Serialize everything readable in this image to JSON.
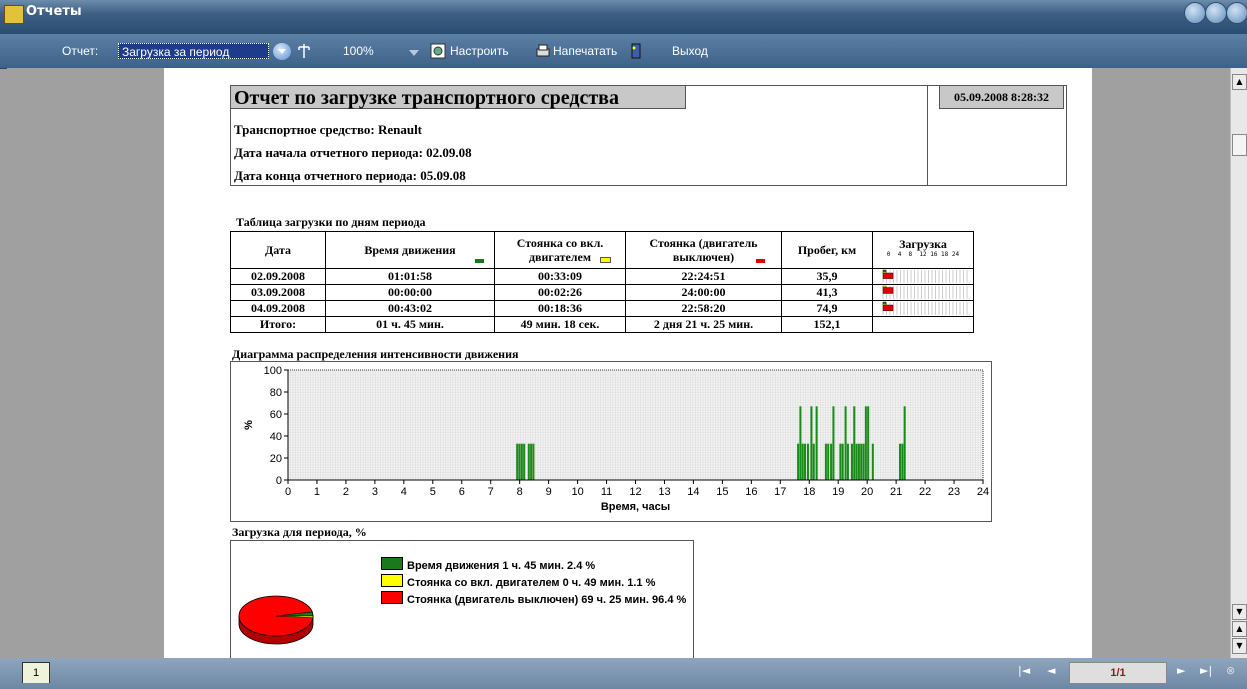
{
  "window": {
    "title": "Отчеты"
  },
  "toolbar": {
    "report_label": "Отчет:",
    "report_value": "Загрузка за период",
    "zoom": "100%",
    "configure_label": "Настроить",
    "print_label": "Напечатать",
    "exit_label": "Выход"
  },
  "report": {
    "title": "Отчет по загрузке транспортного средства",
    "generated": "05.09.2008 8:28:32",
    "vehicle": "Транспортное средство: Renault",
    "period_start": "Дата начала отчетного периода: 02.09.08",
    "period_end": "Дата конца отчетного периода: 05.09.08",
    "table_title": "Таблица загрузки по дням периода",
    "columns": [
      "Дата",
      "Время движения",
      "Стоянка со вкл. двигателем",
      "Стоянка (двигатель выключен)",
      "Пробег, км",
      "Загрузка"
    ],
    "mini_axis": "0  4  8  12 16 18 24",
    "rows": [
      {
        "date": "02.09.2008",
        "moving": "01:01:58",
        "idle": "00:33:09",
        "off": "22:24:51",
        "km": "35,9",
        "load": {
          "moving": 0.043,
          "idle": 0.023,
          "off": 0.934
        }
      },
      {
        "date": "03.09.2008",
        "moving": "00:00:00",
        "idle": "00:02:26",
        "off": "24:00:00",
        "km": "41,3",
        "load": {
          "moving": 0.0,
          "idle": 0.002,
          "off": 0.998
        }
      },
      {
        "date": "04.09.2008",
        "moving": "00:43:02",
        "idle": "00:18:36",
        "off": "22:58:20",
        "km": "74,9",
        "load": {
          "moving": 0.03,
          "idle": 0.013,
          "off": 0.957
        }
      }
    ],
    "total": {
      "label": "Итого:",
      "moving": "01 ч. 45 мин.",
      "idle": "49 мин. 18 сек.",
      "off": "2 дня 21 ч. 25 мин.",
      "km": "152,1"
    },
    "chart_title": "Диаграмма распределения интенсивности движения",
    "pie_title": "Загрузка для периода, %",
    "pie_legend": [
      "Время движения 1 ч. 45 мин. 2.4 %",
      "Стоянка со вкл. двигателем 0 ч. 49 мин. 1.1 %",
      "Стоянка (двигатель выключен) 69 ч. 25 мин. 96.4 %"
    ]
  },
  "colors": {
    "moving": "#1a7a1a",
    "idle": "#ffff00",
    "off": "#e00000",
    "bar": "#1a8a1a"
  },
  "pager": {
    "tab": "1",
    "page": "1/1"
  },
  "chart_data": [
    {
      "type": "bar",
      "title": "Диаграмма распределения интенсивности движения",
      "xlabel": "Время, часы",
      "ylabel": "%",
      "xlim": [
        0,
        24
      ],
      "ylim": [
        0,
        100
      ],
      "xticks": [
        0,
        1,
        2,
        3,
        4,
        5,
        6,
        7,
        8,
        9,
        10,
        11,
        12,
        13,
        14,
        15,
        16,
        17,
        18,
        19,
        20,
        21,
        22,
        23,
        24
      ],
      "yticks": [
        0,
        20,
        40,
        60,
        80,
        100
      ],
      "grid": true,
      "bars": [
        {
          "x": 7.88,
          "w": 0.07,
          "y": 33
        },
        {
          "x": 7.96,
          "w": 0.07,
          "y": 33
        },
        {
          "x": 8.04,
          "w": 0.07,
          "y": 33
        },
        {
          "x": 8.12,
          "w": 0.07,
          "y": 33
        },
        {
          "x": 8.28,
          "w": 0.07,
          "y": 33
        },
        {
          "x": 8.36,
          "w": 0.07,
          "y": 33
        },
        {
          "x": 8.44,
          "w": 0.07,
          "y": 33
        },
        {
          "x": 17.58,
          "w": 0.07,
          "y": 33
        },
        {
          "x": 17.66,
          "w": 0.07,
          "y": 67
        },
        {
          "x": 17.74,
          "w": 0.07,
          "y": 33
        },
        {
          "x": 17.82,
          "w": 0.07,
          "y": 33
        },
        {
          "x": 17.92,
          "w": 0.07,
          "y": 33
        },
        {
          "x": 18.04,
          "w": 0.07,
          "y": 67
        },
        {
          "x": 18.12,
          "w": 0.07,
          "y": 33
        },
        {
          "x": 18.22,
          "w": 0.07,
          "y": 67
        },
        {
          "x": 18.54,
          "w": 0.07,
          "y": 33
        },
        {
          "x": 18.62,
          "w": 0.07,
          "y": 33
        },
        {
          "x": 18.72,
          "w": 0.07,
          "y": 33
        },
        {
          "x": 18.8,
          "w": 0.07,
          "y": 67
        },
        {
          "x": 19.04,
          "w": 0.07,
          "y": 33
        },
        {
          "x": 19.12,
          "w": 0.07,
          "y": 33
        },
        {
          "x": 19.22,
          "w": 0.07,
          "y": 67
        },
        {
          "x": 19.3,
          "w": 0.07,
          "y": 33
        },
        {
          "x": 19.44,
          "w": 0.07,
          "y": 33
        },
        {
          "x": 19.52,
          "w": 0.07,
          "y": 67
        },
        {
          "x": 19.6,
          "w": 0.07,
          "y": 33
        },
        {
          "x": 19.68,
          "w": 0.07,
          "y": 33
        },
        {
          "x": 19.76,
          "w": 0.07,
          "y": 33
        },
        {
          "x": 19.84,
          "w": 0.07,
          "y": 33
        },
        {
          "x": 19.92,
          "w": 0.07,
          "y": 67
        },
        {
          "x": 20.0,
          "w": 0.07,
          "y": 67
        },
        {
          "x": 20.16,
          "w": 0.07,
          "y": 33
        },
        {
          "x": 21.1,
          "w": 0.07,
          "y": 33
        },
        {
          "x": 21.18,
          "w": 0.07,
          "y": 33
        },
        {
          "x": 21.26,
          "w": 0.07,
          "y": 67
        }
      ]
    },
    {
      "type": "pie",
      "title": "Загрузка для периода, %",
      "categories": [
        "Время движения",
        "Стоянка со вкл. двигателем",
        "Стоянка (двигатель выключен)"
      ],
      "values": [
        2.4,
        1.1,
        96.4
      ]
    }
  ]
}
